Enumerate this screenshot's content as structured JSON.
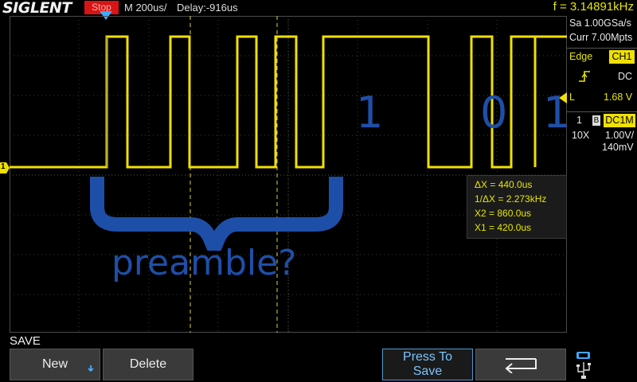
{
  "header": {
    "brand": "SIGLENT",
    "run_status": "Stop",
    "timebase": "M 200us/",
    "delay": "Delay:-916us",
    "frequency": "f = 3.14891kHz"
  },
  "acquisition": {
    "sample_rate": "Sa 1.00GSa/s",
    "memory_depth": "Curr 7.00Mpts"
  },
  "trigger": {
    "type_label": "Edge",
    "source": "CH1",
    "slope_icon": "rising-edge-icon",
    "coupling": "DC",
    "level_label": "L",
    "level_value": "1.68 V"
  },
  "channel": {
    "number": "1",
    "bw_limit": "B",
    "coupling": "DC1M",
    "probe": "10X",
    "volts_div": "1.00V/",
    "offset": "140mV",
    "marker": "1"
  },
  "cursor_readout": {
    "delta_x": "ΔX = 440.0us",
    "inverse_delta_x": "1/ΔX = 2.273kHz",
    "x2": "X2 = 860.0us",
    "x1": "X1 = 420.0us"
  },
  "annotations": {
    "bit_1a": "1",
    "bit_0": "0",
    "bit_1b": "1",
    "preamble": "preamble?"
  },
  "menu": {
    "title": "SAVE",
    "new_label": "New",
    "delete_label": "Delete",
    "press_to_save_line1": "Press To",
    "press_to_save_line2": "Save",
    "return_icon": "return-arrow-icon",
    "usb_icon": "usb-icon"
  },
  "colors": {
    "trace": "#f0e000",
    "run_status_bg": "#d81414",
    "annotation": "#1e4fa8",
    "cursor_line": "#e6e600",
    "accent_button": "#4a9ad8"
  }
}
